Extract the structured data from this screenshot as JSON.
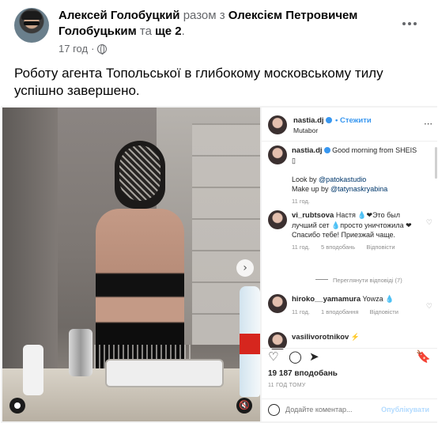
{
  "post": {
    "author": "Алексей Голобуцкий",
    "with_word": "разом з",
    "tagged": "Олексієм Петровичем Голобуцьким",
    "and_word": "та",
    "others": "ще 2",
    "time": "17 год",
    "dot": "·",
    "text": "Роботу агента Топольської в глибокому московському тилу успішно завершено."
  },
  "instagram": {
    "header": {
      "handle": "nastia.dj",
      "follow_label": "• Стежити",
      "location": "Mutabor"
    },
    "caption": {
      "handle": "nastia.dj",
      "text": "Good morning from SHEIS",
      "box": "▯",
      "look_by": "Look by",
      "look_link": "@patokastudio",
      "makeup_by": "Make up by",
      "makeup_link": "@tatynaskryabina",
      "time": "11 год."
    },
    "comments": [
      {
        "handle": "vi_rubtsova",
        "text": "Настя 💧❤Это был лучший сет 💧просто уничтожила ❤Спасибо тебе! Приезжай чаще.",
        "time": "11 год.",
        "likes": "5 вподобань",
        "reply": "Відповісти"
      },
      {
        "handle": "hiroko__yamamura",
        "text": "Yowza 💧",
        "time": "11 год.",
        "likes": "1 вподобання",
        "reply": "Відповісти"
      },
      {
        "handle": "vasilivorotnikov",
        "text": "⚡",
        "time": "",
        "likes": "",
        "reply": ""
      }
    ],
    "view_replies": "Переглянути відповіді (7)",
    "likes_count": "19 187 вподобань",
    "posted_ago": "11 ГОД ТОМУ",
    "comment_placeholder": "Додайте коментар...",
    "publish_label": "Опублікувати"
  },
  "icons": {
    "more": "more-horizontal-icon",
    "globe": "globe-icon",
    "heart": "♡",
    "comment": "◯",
    "share": "➤",
    "bookmark": "🔖",
    "next": "›",
    "mute": "🔇",
    "small_heart": "♡"
  },
  "colors": {
    "link_blue": "#3897f0",
    "text_muted": "#65676b",
    "ig_meta": "#8e8e8e"
  }
}
